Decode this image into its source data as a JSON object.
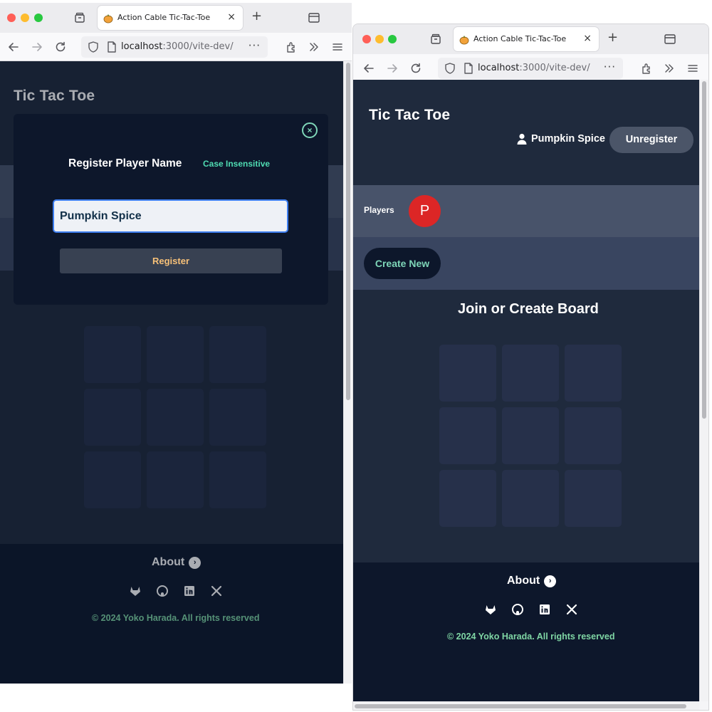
{
  "browser": {
    "tab_title": "Action Cable Tic-Tac-Toe",
    "url_host": "localhost",
    "url_rest": ":3000/vite-dev/",
    "tab_close": "×",
    "new_tab": "+",
    "more": "···"
  },
  "app": {
    "title": "Tic Tac Toe",
    "footer": {
      "about_label": "About",
      "about_arrow": "›",
      "copyright": "© 2024 Yoko Harada. All rights reserved",
      "social_icons": [
        "gitlab-icon",
        "github-icon",
        "linkedin-icon",
        "x-icon"
      ]
    }
  },
  "modal": {
    "title": "Register Player Name",
    "hint": "Case Insensitive",
    "input_value": "Pumpkin Spice",
    "register_label": "Register",
    "close_glyph": "×"
  },
  "window2": {
    "username": "Pumpkin Spice",
    "unregister_label": "Unregister",
    "players_label": "Players",
    "avatar_letter": "P",
    "create_label": "Create New",
    "board_heading": "Join or Create Board"
  },
  "colors": {
    "page_bg": "#1f2a3d",
    "footer_bg": "#0d172b",
    "accent_green": "#7ed6b8",
    "avatar_red": "#dc2626",
    "register_text": "#f6c078"
  }
}
